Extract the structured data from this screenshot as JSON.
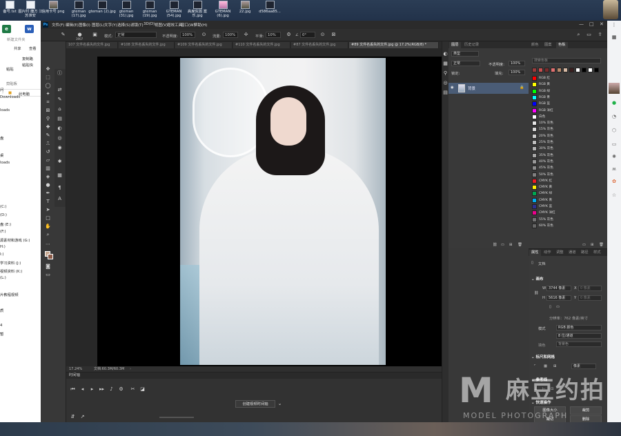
{
  "desktop": {
    "icons": [
      {
        "label": "备号.txt",
        "kind": "doc"
      },
      {
        "label": "图片时 魔方 江苏淮安",
        "kind": "doc"
      },
      {
        "label": "信用卡号 png",
        "kind": "photo"
      },
      {
        "label": "gteman (17).jpg",
        "kind": "dark"
      },
      {
        "label": "gteman (2).jpg",
        "kind": "dark"
      },
      {
        "label": "gteman (31).jpg",
        "kind": "dark"
      },
      {
        "label": "gteman (19).jpg",
        "kind": "dark"
      },
      {
        "label": "GTEMAN (54).jpg",
        "kind": "dark"
      },
      {
        "label": "高度贫困 案乐.jpg",
        "kind": "dark"
      },
      {
        "label": "GTEMAN (6).jpg",
        "kind": "pink"
      },
      {
        "label": "22.jpg",
        "kind": "photo"
      },
      {
        "label": "d586aa85...",
        "kind": "dark"
      }
    ]
  },
  "explorer": {
    "new_folder": "新建文件夹",
    "ribbon_tabs": [
      "共享",
      "查看"
    ],
    "actions": [
      "复制路",
      "粘贴快"
    ],
    "paste": "粘贴",
    "clipboard": "剪贴板",
    "address": "此电脑",
    "nav": [
      "问",
      "Downloads",
      "loads",
      "盘",
      "桌",
      "loads",
      "(C:)",
      "(D:)",
      "盘 (E:)",
      "(F:)",
      "源素材和游戏 (G:)",
      "H:)",
      "I:)",
      "学习资料 (J:)",
      "视频资料 (K:)",
      "(L:)",
      "片教程视频",
      "质",
      "4",
      "暂"
    ]
  },
  "photoshop": {
    "logo": "Ps",
    "menu": [
      "文件(F)",
      "编辑(E)",
      "图像(I)",
      "图层(L)",
      "文字(Y)",
      "选择(S)",
      "滤镜(T)",
      "3D(D)",
      "视图(V)",
      "增效工具",
      "窗口(W)",
      "帮助(H)"
    ],
    "window_controls": [
      "—",
      "□",
      "✕"
    ],
    "options": {
      "brush_size": "3907",
      "mode_label": "模式:",
      "mode_value": "正常",
      "opacity_label": "不透明度:",
      "opacity_value": "100%",
      "flow_label": "流量:",
      "flow_value": "100%",
      "smooth_label": "平滑:",
      "smooth_value": "10%",
      "angle_value": "0°"
    },
    "tabs": [
      {
        "label": "107 文件名丢失的文件.jpg",
        "active": false
      },
      {
        "label": "#108 文件名丢失的文件.jpg",
        "active": false
      },
      {
        "label": "#109 文件名丢失的文件.jpg",
        "active": false
      },
      {
        "label": "#110 文件名丢失的文件.jpg",
        "active": false
      },
      {
        "label": "#87 文件名丢失的文件.jpg",
        "active": false
      },
      {
        "label": "#89 文件名丢失的文件.jpg @ 17.2%(RGB/8) *",
        "active": true
      }
    ],
    "status": {
      "zoom": "17.24%",
      "doc_size": "文档:60.3M/60.3M"
    },
    "timeline": {
      "title": "时间轴",
      "create_button": "创建视频时间轴"
    },
    "layers": {
      "tabs": [
        "图层",
        "历史记录"
      ],
      "kind_label": "类型",
      "blend": "正常",
      "opacity_label": "不透明度:",
      "opacity_value": "100%",
      "lock_label": "锁定:",
      "fill_label": "填充:",
      "fill_value": "100%",
      "layer_name": "背景"
    },
    "swatches": {
      "tabs": [
        "颜色",
        "色板",
        "图案"
      ],
      "search_placeholder": "搜索色板",
      "top_colors": [
        "#9a3b3b",
        "#c75050",
        "#7a2c2c",
        "#e07070",
        "#b98a6a",
        "#d6b9a4",
        "#3a1f1f",
        "#ffffff",
        "#000000",
        "#ffffff",
        "#000000"
      ],
      "rows": [
        {
          "name": "RGB 红",
          "color": "#ff0000"
        },
        {
          "name": "RGB 黄",
          "color": "#ffff00"
        },
        {
          "name": "RGB 绿",
          "color": "#00ff00"
        },
        {
          "name": "RGB 青",
          "color": "#00ffff"
        },
        {
          "name": "RGB 蓝",
          "color": "#0000ff"
        },
        {
          "name": "RGB 洋红",
          "color": "#ff00ff"
        },
        {
          "name": "白色",
          "color": "#ffffff"
        },
        {
          "name": "10% 灰色",
          "color": "#e6e6e6"
        },
        {
          "name": "15% 灰色",
          "color": "#d9d9d9"
        },
        {
          "name": "20% 灰色",
          "color": "#cccccc"
        },
        {
          "name": "25% 灰色",
          "color": "#bfbfbf"
        },
        {
          "name": "30% 灰色",
          "color": "#b3b3b3"
        },
        {
          "name": "35% 灰色",
          "color": "#a6a6a6"
        },
        {
          "name": "40% 灰色",
          "color": "#999999"
        },
        {
          "name": "45% 灰色",
          "color": "#8c8c8c"
        },
        {
          "name": "50% 灰色",
          "color": "#808080"
        },
        {
          "name": "CMYK 红",
          "color": "#ed1c24"
        },
        {
          "name": "CMYK 黄",
          "color": "#fff200"
        },
        {
          "name": "CMYK 绿",
          "color": "#00a651"
        },
        {
          "name": "CMYK 青",
          "color": "#00aeef"
        },
        {
          "name": "CMYK 蓝",
          "color": "#2e3192"
        },
        {
          "name": "CMYK 洋红",
          "color": "#ec008c"
        },
        {
          "name": "55% 灰色",
          "color": "#737373"
        },
        {
          "name": "60% 灰色",
          "color": "#666666"
        }
      ]
    },
    "properties": {
      "tabs": [
        "属性",
        "动作",
        "调整",
        "通道",
        "路径",
        "样式"
      ],
      "doc_label": "文档",
      "canvas_section": "画布",
      "w_label": "W",
      "w_value": "3744 像素",
      "h_label": "H",
      "h_value": "5616 像素",
      "x_label": "X",
      "x_placeholder": "0 像素",
      "y_label": "Y",
      "y_placeholder": "0 像素",
      "resolution": "分辨率：762 像素/英寸",
      "mode_label": "模式",
      "mode_value": "RGB 颜色",
      "depth_value": "8 位/通道",
      "bg_label": "填色",
      "bg_value": "背景色",
      "ruler_section": "标尺和网格",
      "ruler_unit": "像素",
      "guides_section": "参考线",
      "quick_section": "快速操作",
      "image_size_btn": "图像大小",
      "crop_btn": "裁剪",
      "flatten_btn": "删除",
      "trim_btn": "裁切"
    }
  },
  "watermark": {
    "letter": "M",
    "chinese": "麻豆约拍",
    "english": "MODEL PHOTOGRAPH"
  }
}
